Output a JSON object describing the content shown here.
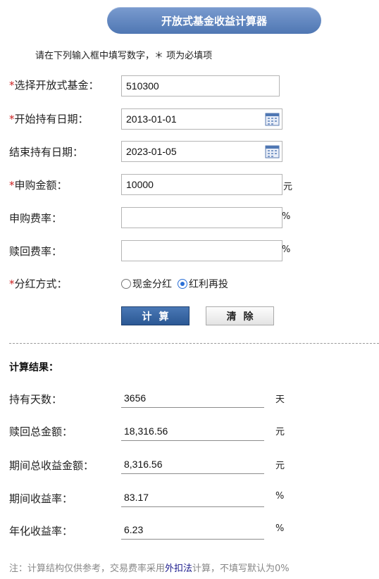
{
  "header": {
    "title": "开放式基金收益计算器"
  },
  "instruction": "请在下列输入框中填写数字，＊ 项为必填项",
  "form": {
    "star": "*",
    "fund": {
      "label": "选择开放式基金：",
      "value": "510300"
    },
    "start_date": {
      "label": "开始持有日期：",
      "value": "2013-01-01"
    },
    "end_date": {
      "label": "结束持有日期：",
      "value": "2023-01-05"
    },
    "amount": {
      "label": "申购金额：",
      "value": "10000",
      "unit": "元"
    },
    "purchase_fee": {
      "label": "申购费率：",
      "value": "",
      "unit": "%"
    },
    "redeem_fee": {
      "label": "赎回费率：",
      "value": "",
      "unit": "%"
    },
    "dividend": {
      "label": "分红方式：",
      "options": [
        "现金分红",
        "红利再投"
      ],
      "selected": "红利再投"
    },
    "calculate_label": "计算",
    "clear_label": "清除"
  },
  "results": {
    "heading": "计算结果：",
    "rows": [
      {
        "label": "持有天数：",
        "value": "3656",
        "unit": "天"
      },
      {
        "label": "赎回总金额：",
        "value": "18,316.56",
        "unit": "元"
      },
      {
        "label": "期间总收益金额：",
        "value": "8,316.56",
        "unit": "元"
      },
      {
        "label": "期间收益率：",
        "value": "83.17",
        "unit": "%"
      },
      {
        "label": "年化收益率：",
        "value": "6.23",
        "unit": "%"
      }
    ]
  },
  "note": {
    "prefix": "注：计算结构仅供参考，交易费率采用",
    "link": "外扣法",
    "suffix": "计算，不填写默认为0%"
  }
}
